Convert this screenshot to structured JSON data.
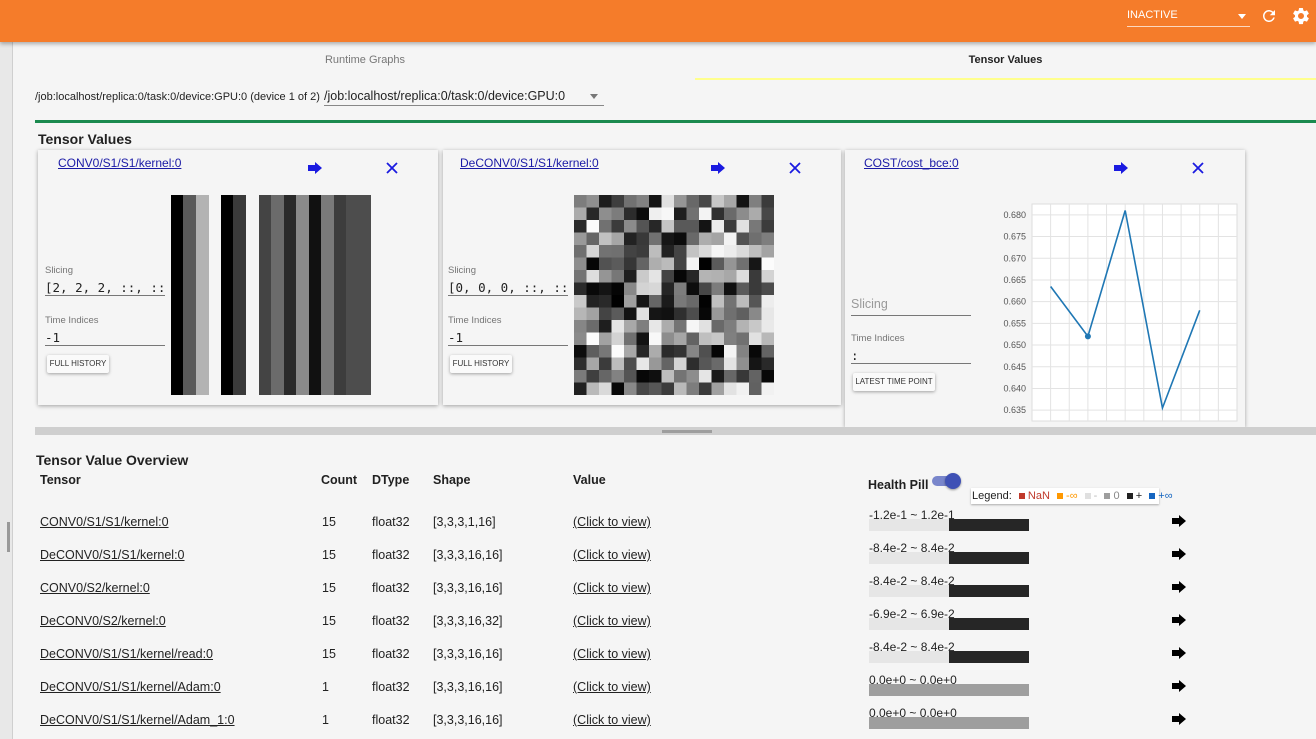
{
  "topbar": {
    "status": "INACTIVE",
    "status_options_selected": "INACTIVE",
    "reload_icon": "reload-icon",
    "settings_icon": "gear-icon",
    "accent": "#f57c2a"
  },
  "tabs": [
    {
      "label": "Runtime Graphs"
    },
    {
      "label": "Tensor Values"
    }
  ],
  "device": {
    "label": "/job:localhost/replica:0/task:0/device:GPU:0 (device 1 of 2)",
    "selected": "/job:localhost/replica:0/task:0/device:GPU:0"
  },
  "tensor_values": {
    "title": "Tensor Values",
    "cards": [
      {
        "name": "CONV0/S1/S1/kernel:0",
        "slicing_label": "Slicing",
        "slicing": "[2, 2, 2, ::, ::]",
        "time_label": "Time Indices",
        "time": "-1",
        "button": "FULL HISTORY"
      },
      {
        "name": "DeCONV0/S1/S1/kernel:0",
        "slicing_label": "Slicing",
        "slicing": "[0, 0, 0, ::, ::]",
        "time_label": "Time Indices",
        "time": "-1",
        "button": "FULL HISTORY"
      },
      {
        "name": "COST/cost_bce:0",
        "slicing_label": "Slicing",
        "slicing": "",
        "time_label": "Time Indices",
        "time": ":",
        "button": "LATEST TIME POINT"
      }
    ]
  },
  "chart_data": {
    "type": "line",
    "x": [
      0,
      1,
      2,
      3,
      4
    ],
    "values": [
      0.6635,
      0.652,
      0.681,
      0.6355,
      0.658
    ],
    "ylim": [
      0.6325,
      0.6825
    ],
    "yticks": [
      "0.635",
      "0.640",
      "0.645",
      "0.650",
      "0.655",
      "0.660",
      "0.665",
      "0.670",
      "0.675",
      "0.680"
    ],
    "grid": true,
    "color": "#1f77b4"
  },
  "overview": {
    "title": "Tensor Value Overview",
    "headers": {
      "tensor": "Tensor",
      "count": "Count",
      "dtype": "DType",
      "shape": "Shape",
      "value": "Value"
    },
    "health_pill_label": "Health Pill",
    "legend": {
      "prefix": "Legend:",
      "nan": "NaN",
      "neg_inf": "-∞",
      "neg": "-",
      "zero": "0",
      "pos": "+",
      "pos_inf": "+∞"
    },
    "rows": [
      {
        "tensor": "CONV0/S1/S1/kernel:0",
        "count": "15",
        "dtype": "float32",
        "shape": "[3,3,3,1,16]",
        "value": "(Click to view)",
        "range": "-1.2e-1 ~ 1.2e-1",
        "dark_frac": 0.5
      },
      {
        "tensor": "DeCONV0/S1/S1/kernel:0",
        "count": "15",
        "dtype": "float32",
        "shape": "[3,3,3,16,16]",
        "value": "(Click to view)",
        "range": "-8.4e-2 ~ 8.4e-2",
        "dark_frac": 0.5
      },
      {
        "tensor": "CONV0/S2/kernel:0",
        "count": "15",
        "dtype": "float32",
        "shape": "[3,3,3,16,16]",
        "value": "(Click to view)",
        "range": "-8.4e-2 ~ 8.4e-2",
        "dark_frac": 0.5
      },
      {
        "tensor": "DeCONV0/S2/kernel:0",
        "count": "15",
        "dtype": "float32",
        "shape": "[3,3,3,16,32]",
        "value": "(Click to view)",
        "range": "-6.9e-2 ~ 6.9e-2",
        "dark_frac": 0.5
      },
      {
        "tensor": "DeCONV0/S1/S1/kernel/read:0",
        "count": "15",
        "dtype": "float32",
        "shape": "[3,3,3,16,16]",
        "value": "(Click to view)",
        "range": "-8.4e-2 ~ 8.4e-2",
        "dark_frac": 0.5
      },
      {
        "tensor": "DeCONV0/S1/S1/kernel/Adam:0",
        "count": "1",
        "dtype": "float32",
        "shape": "[3,3,3,16,16]",
        "value": "(Click to view)",
        "range": "0.0e+0 ~ 0.0e+0",
        "dark_frac": 0
      },
      {
        "tensor": "DeCONV0/S1/S1/kernel/Adam_1:0",
        "count": "1",
        "dtype": "float32",
        "shape": "[3,3,3,16,16]",
        "value": "(Click to view)",
        "range": "0.0e+0 ~ 0.0e+0",
        "dark_frac": 0
      }
    ]
  }
}
